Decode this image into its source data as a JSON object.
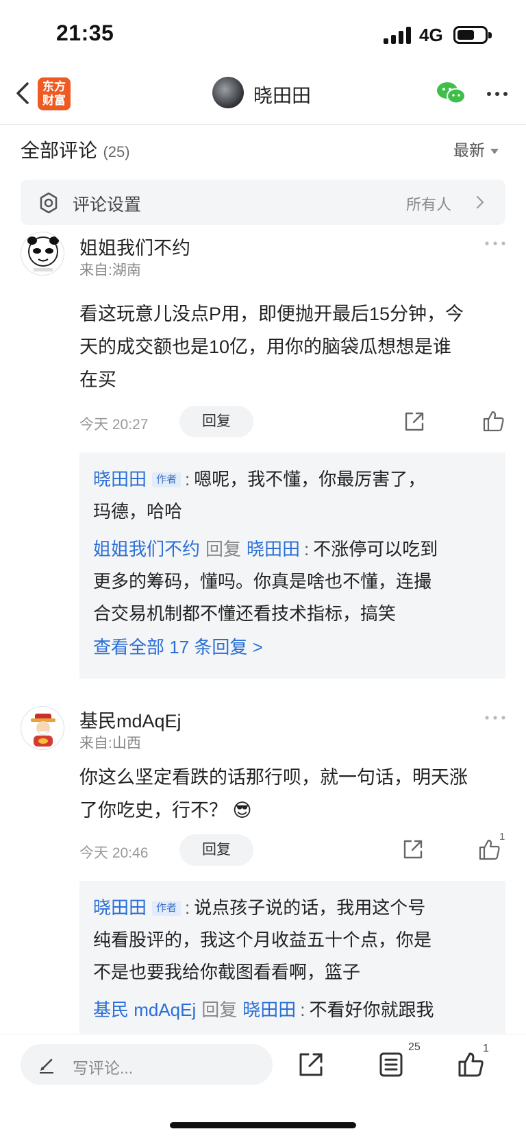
{
  "status": {
    "time": "21:35",
    "network": "4G"
  },
  "nav": {
    "logo_text_line1": "东方",
    "logo_text_line2": "财富",
    "title": "晓田田"
  },
  "comments_header": {
    "title": "全部评论",
    "count": "(25)",
    "sort_label": "最新"
  },
  "settings": {
    "label": "评论设置",
    "value": "所有人"
  },
  "comments": [
    {
      "author": "姐姐我们不约",
      "location": "来自:湖南",
      "body_lines": [
        "看这玩意儿没点P用，即便抛开最后15分钟，今",
        "天的成交额也是10亿，用你的脑袋瓜想想是谁",
        "在买"
      ],
      "time": "今天 20:27",
      "reply_label": "回复",
      "replies": [
        {
          "name": "晓田田",
          "tag": "作者",
          "text_line1": "嗯呢，我不懂，你最厉害了，",
          "text_line2": "玛德，哈哈"
        },
        {
          "name": "姐姐我们不约",
          "reply_word": "回复",
          "target": "晓田田",
          "text_line1": "不涨停可以吃到",
          "text_line2": "更多的筹码，懂吗。你真是啥也不懂，连撮",
          "text_line3": "合交易机制都不懂还看技术指标，搞笑"
        }
      ],
      "view_all": "查看全部 17 条回复 >"
    },
    {
      "author": "基民mdAqEj",
      "location": "来自:山西",
      "body_lines": [
        "你这么坚定看跌的话那行呗，就一句话，明天涨",
        "了你吃史，行不？"
      ],
      "emoji": "😎",
      "time": "今天 20:46",
      "reply_label": "回复",
      "like_count": "1",
      "replies": [
        {
          "name": "晓田田",
          "tag": "作者",
          "text_line1": "说点孩子说的话，我用这个号",
          "text_line2": "纯看股评的，我这个月收益五十个点，你是",
          "text_line3": "不是也要我给你截图看看啊，篮子"
        },
        {
          "name": "基民 mdAqEj",
          "reply_word": "回复",
          "target": "晓田田",
          "text_line1": "不看好你就跟我"
        }
      ]
    }
  ],
  "bottom": {
    "input_placeholder": "写评论...",
    "comment_count": "25",
    "like_count": "1"
  },
  "colors": {
    "accent_blue": "#2a6fd6",
    "brand_orange": "#ef5a22",
    "wechat_green": "#3fbf4a"
  }
}
